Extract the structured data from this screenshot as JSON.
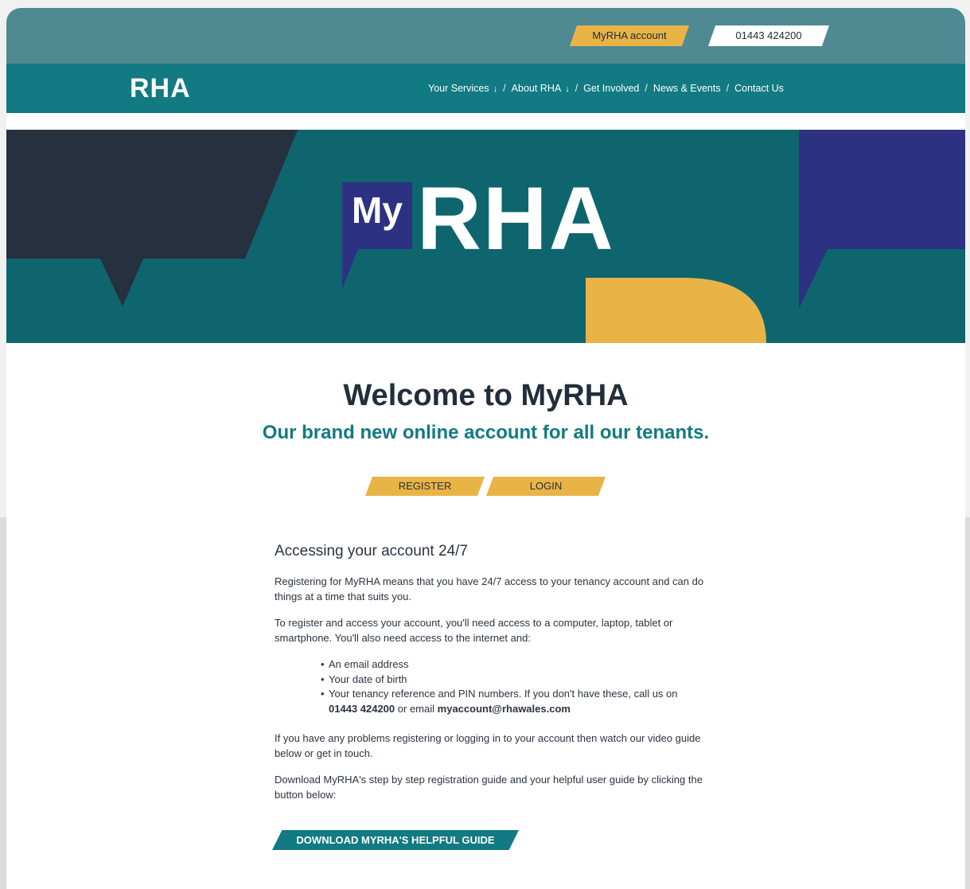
{
  "topbar": {
    "account_label": "MyRHA account",
    "phone_label": "01443 424200"
  },
  "header": {
    "logo_text": "RHA",
    "nav": [
      {
        "label": "Your Services",
        "dropdown_icon": "arrow-down-icon"
      },
      {
        "label": "About RHA",
        "dropdown_icon": "arrow-down-icon"
      },
      {
        "label": "Get Involved"
      },
      {
        "label": "News & Events"
      },
      {
        "label": "Contact Us"
      }
    ],
    "separator": "/",
    "arrow_glyph": "↓"
  },
  "hero": {
    "logo_my": "My",
    "logo_rha": "RHA"
  },
  "main": {
    "title": "Welcome to MyRHA",
    "subtitle": "Our brand new online account for all our tenants.",
    "register_label": "REGISTER",
    "login_label": "LOGIN"
  },
  "info": {
    "heading": "Accessing your account 24/7",
    "para1": "Registering for MyRHA means that you have 24/7 access to your tenancy account and can do things at a time that suits you.",
    "para2": "To register and access your account, you'll need access to a computer, laptop, tablet or smartphone. You'll also need access to the internet and:",
    "list": [
      "An email address",
      "Your date of birth"
    ],
    "list3_text": "Your tenancy reference and PIN numbers. If you don't have these, call us on",
    "list3_phone": "01443 424200",
    "list3_or": "or email",
    "list3_email": "myaccount@rhawales.com",
    "para3": "If you have any problems registering or logging in to your account then watch our video guide below or get in touch.",
    "para4": "Download MyRHA's step by step registration guide and your helpful user guide by clicking the button below:",
    "download_label": "DOWNLOAD MYRHA'S HELPFUL GUIDE"
  },
  "colors": {
    "topbar": "#4f8a92",
    "navbar": "#117a82",
    "accent_yellow": "#e9b446",
    "hero_teal": "#0f656d",
    "hero_navy": "#26303f",
    "hero_indigo": "#2d3182",
    "heading_dark": "#222e3b"
  }
}
